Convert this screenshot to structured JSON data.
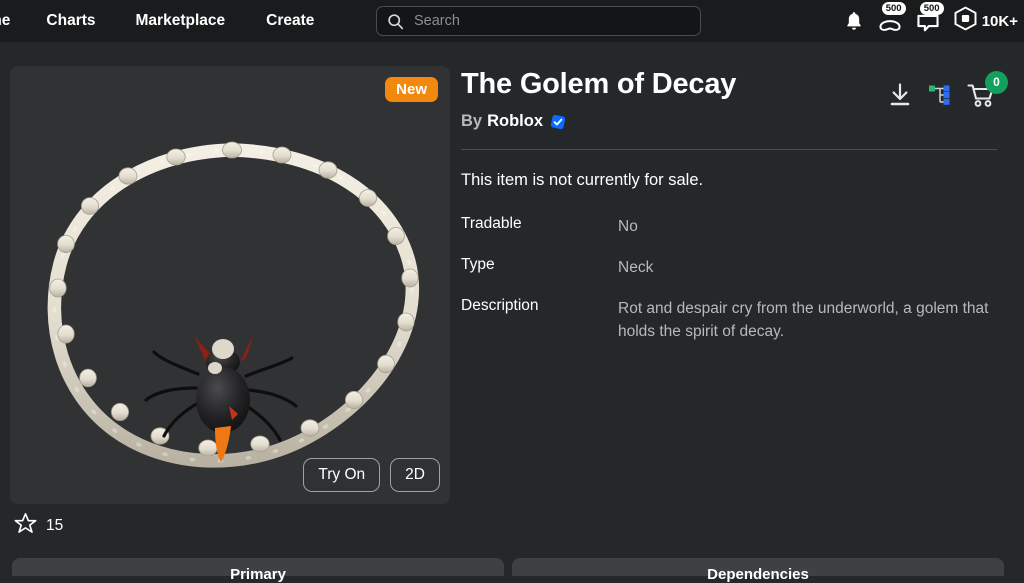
{
  "navbar": {
    "links": [
      {
        "label": "me",
        "name": "nav-link-home"
      },
      {
        "label": "Charts",
        "name": "nav-link-charts"
      },
      {
        "label": "Marketplace",
        "name": "nav-link-marketplace"
      },
      {
        "label": "Create",
        "name": "nav-link-create"
      }
    ],
    "search": {
      "placeholder": "Search",
      "value": ""
    },
    "notifications_icon": "bell-icon",
    "friends": {
      "icon": "friends-icon",
      "badge": "500"
    },
    "chat": {
      "icon": "chat-icon",
      "badge": "500"
    },
    "robux": {
      "icon": "robux-icon",
      "amount": "10K+"
    }
  },
  "preview": {
    "new_badge": "New",
    "try_on_label": "Try On",
    "view_2d_label": "2D",
    "favorites_count": "15",
    "favorite_icon": "star-icon"
  },
  "item": {
    "title": "The Golem of Decay",
    "by_label": "By",
    "creator": "Roblox",
    "verified": true,
    "sale_status": "This item is not currently for sale.",
    "attributes": [
      {
        "key": "Tradable",
        "value": "No"
      },
      {
        "key": "Type",
        "value": "Neck"
      },
      {
        "key": "Description",
        "value": "Rot and despair cry from the underworld, a golem that holds the spirit of decay."
      }
    ],
    "actions": {
      "download_icon": "download-icon",
      "dependency_tree_icon": "dependency-tree-icon",
      "cart_icon": "shopping-cart-icon",
      "cart_count": "0"
    }
  },
  "bottom": {
    "primary_label": "Primary",
    "dependencies_label": "Dependencies"
  },
  "colors": {
    "page_bg": "#24282a",
    "nav_bg": "#191b1d",
    "card_bg": "#303234",
    "panel_bg": "#3d4144",
    "accent_orange": "#f2880d",
    "accent_green": "#12a05c",
    "verified_blue": "#0b6cff"
  }
}
